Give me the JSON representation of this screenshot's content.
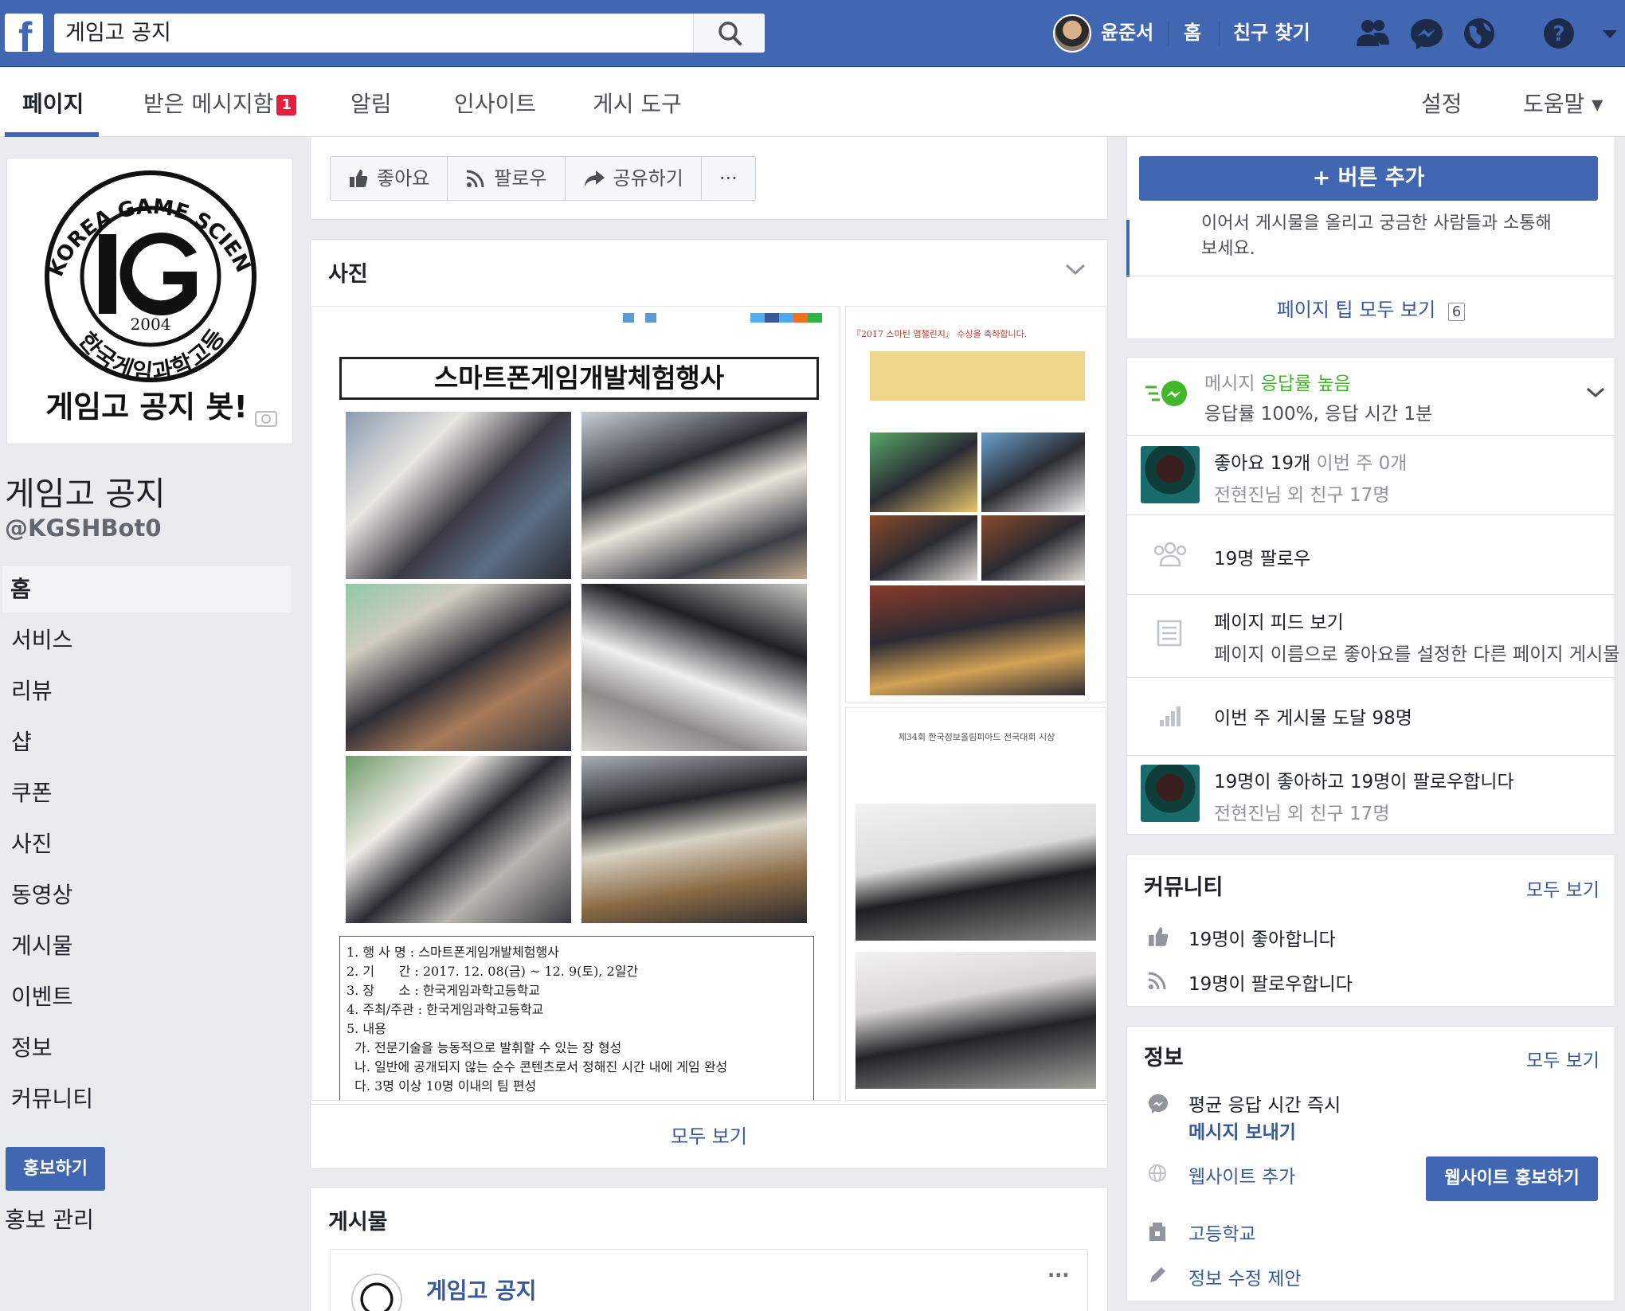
{
  "topbar": {
    "search_value": "게임고 공지",
    "user_name": "윤준서",
    "home": "홈",
    "find_friends": "친구 찾기"
  },
  "pagenav": {
    "page": "페이지",
    "inbox": "받은 메시지함",
    "inbox_badge": "1",
    "notifications": "알림",
    "insights": "인사이트",
    "publishing_tools": "게시 도구",
    "settings": "설정",
    "help": "도움말 ▾"
  },
  "profile": {
    "logo_arc": "KOREA GAME SCIENCE HIGH SCHOOL",
    "logo_year": "2004",
    "logo_arc_kr": "한국게임과학고등학교",
    "logo_caption": "게임고 공지 봇!",
    "name": "게임고 공지",
    "handle": "@KGSHBot0"
  },
  "left_nav": [
    "홈",
    "서비스",
    "리뷰",
    "샵",
    "쿠폰",
    "사진",
    "동영상",
    "게시물",
    "이벤트",
    "정보",
    "커뮤니티"
  ],
  "promote": {
    "button": "홍보하기",
    "manage": "홍보 관리"
  },
  "actions": {
    "like": "좋아요",
    "follow": "팔로우",
    "share": "공유하기",
    "more": "···"
  },
  "photos": {
    "title": "사진",
    "doc_title": "스마트폰게임개발체험행사",
    "doc_lines": [
      "1. 행 사 명 : 스마트폰게임개발체험행사",
      "2. 기      간 : 2017. 12. 08(금) ~ 12. 9(토), 2일간",
      "3. 장      소 : 한국게임과학고등학교",
      "4. 주최/주관 : 한국게임과학고등학교",
      "5. 내용",
      "  가. 전문기술을 능동적으로 발휘할 수 있는 장 형성",
      "  나. 일반에 공개되지 않는 순수 콘텐츠로서 정해진 시간 내에 게임 완성",
      "  다. 3명 이상 10명 이내의 팀 편성"
    ],
    "side1_title": "『2017 스마틴 앱챌린지』 수상을 축하합니다.",
    "side2_title": "제34회 한국정보올림피아드 전국대회 시상",
    "see_all": "모두 보기"
  },
  "posts": {
    "title": "게시물",
    "author": "게임고 공지",
    "more": "···"
  },
  "right": {
    "add_button": "+ 버튼 추가",
    "tip_text_1": "이어서 게시물을 올리고 궁금한 사람들과 소통해",
    "tip_text_2": "보세요.",
    "tips_link": "페이지 팁 모두 보기",
    "tips_count": "6",
    "msg_label": "메시지",
    "msg_high": "응답률 높음",
    "msg_detail": "응답률 100%, 응답 시간 1분",
    "likes": "좋아요 19개",
    "likes_week": "이번 주 0개",
    "friends_1": "전현진님 외 친구 17명",
    "followers": "19명 팔로우",
    "feed_title": "페이지 피드 보기",
    "feed_desc": "페이지 이름으로 좋아요를 설정한 다른 페이지 게시물",
    "reach": "이번 주 게시물 도달 98명",
    "like_follow": "19명이 좋아하고 19명이 팔로우합니다",
    "friends_2": "전현진님 외 친구 17명",
    "community_title": "커뮤니티",
    "community_all": "모두 보기",
    "community_likes": "19명이 좋아합니다",
    "community_follows": "19명이 팔로우합니다",
    "info_title": "정보",
    "info_all": "모두 보기",
    "response_time": "평균 응답 시간 즉시",
    "send_message": "메시지 보내기",
    "add_website": "웹사이트 추가",
    "promote_website": "웹사이트 홍보하기",
    "category": "고등학교",
    "suggest_edit": "정보 수정 제안"
  },
  "colors": {
    "brand": "#4267b2",
    "link": "#385898",
    "green": "#42b72a",
    "badge": "#e41e3f"
  }
}
